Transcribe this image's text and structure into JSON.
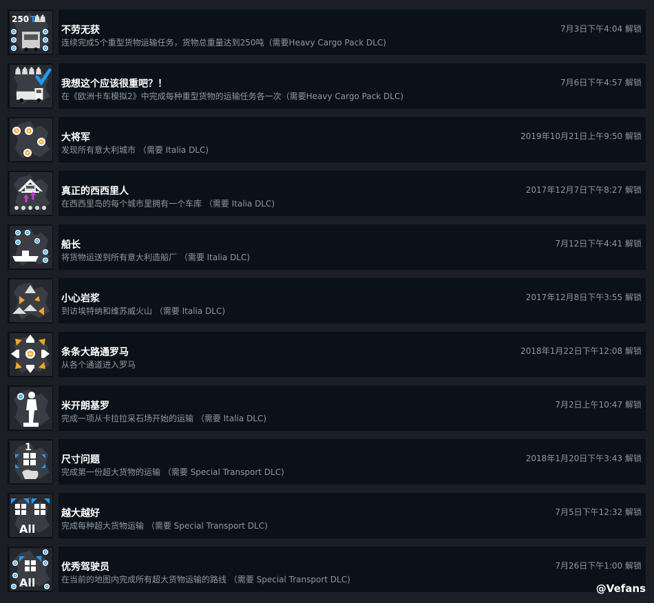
{
  "achievements": [
    {
      "icon": "heavy-cargo-250t-icon",
      "title": "不劳无获",
      "desc": "连续完成5个重型货物运输任务，货物总重量达到250吨（需要Heavy Cargo Pack DLC)",
      "date": "7月3日下午4:04 解锁",
      "badge": "250",
      "badge_unit": "T"
    },
    {
      "icon": "heavy-cargo-check-icon",
      "title": "我想这个应该很重吧？！",
      "desc": "在《欧洲卡车模拟2》中完成每种重型货物的运输任务各一次（需要Heavy Cargo Pack DLC)",
      "date": "7月6日下午4:57 解锁"
    },
    {
      "icon": "italy-cities-icon",
      "title": "大将军",
      "desc": "发现所有意大利城市 （需要 Italia DLC)",
      "date": "2019年10月21日上午9:50 解锁"
    },
    {
      "icon": "sicily-garage-icon",
      "title": "真正的西西里人",
      "desc": "在西西里岛的每个城市里拥有一个车库 （需要 Italia DLC)",
      "date": "2017年12月7日下午8:27 解锁"
    },
    {
      "icon": "shipyard-icon",
      "title": "船长",
      "desc": "将货物运送到所有意大利造船厂 （需要 Italia DLC)",
      "date": "7月12日下午4:41 解锁"
    },
    {
      "icon": "volcano-icon",
      "title": "小心岩浆",
      "desc": "到访埃特纳和维苏威火山 （需要 Italia DLC)",
      "date": "2017年12月8日下午3:55 解锁"
    },
    {
      "icon": "roads-to-rome-icon",
      "title": "条条大路通罗马",
      "desc": "从各个通道进入罗马",
      "date": "2018年1月22日下午12:08 解锁"
    },
    {
      "icon": "david-statue-icon",
      "title": "米开朗基罗",
      "desc": "完成一项从卡拉拉采石场开始的运输 （需要 Italia DLC)",
      "date": "7月2日上午10:47 解锁"
    },
    {
      "icon": "oversize-first-icon",
      "title": "尺寸问题",
      "desc": "完成第一份超大货物的运输 （需要 Special Transport DLC)",
      "date": "2018年1月20日下午3:43 解锁",
      "badge": "1"
    },
    {
      "icon": "oversize-all-icon",
      "title": "越大越好",
      "desc": "完成每种超大货物运输 （需要 Special Transport DLC)",
      "date": "7月5日下午12:32 解锁",
      "badge": "All"
    },
    {
      "icon": "oversize-routes-icon",
      "title": "优秀驾驶员",
      "desc": "在当前的地图内完成所有超大货物运输的路线 （需要 Special Transport DLC)",
      "date": "7月26日下午1:00 解锁",
      "badge": "All"
    }
  ],
  "watermark": "@Vefans"
}
